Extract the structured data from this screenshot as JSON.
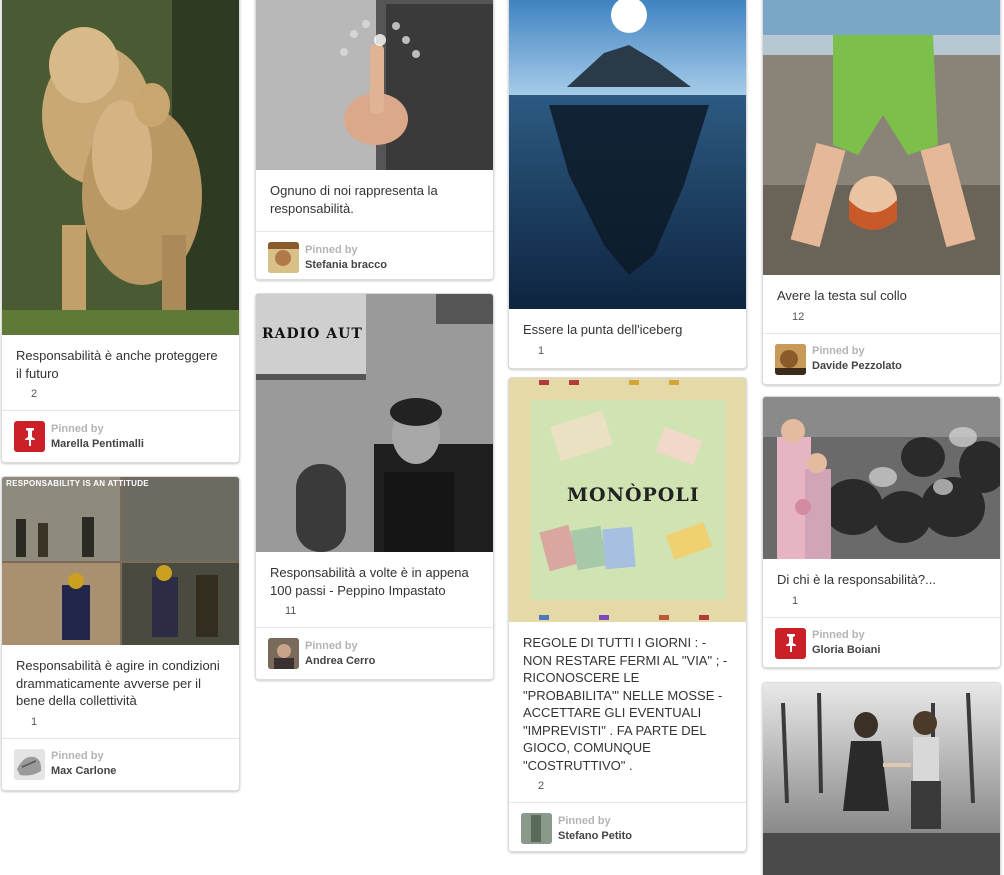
{
  "pinned_by_label": "Pinned by",
  "pins": [
    {
      "description": "Responsabilità è anche proteggere il futuro",
      "repins": "2",
      "pinner": "Marella Pentimalli",
      "image": "lioness-with-cub-photo",
      "avatar": "pinterest-logo-avatar"
    },
    {
      "description": "Responsabilità è agire in condizioni drammaticamente avverse per il bene della collettività",
      "repins": "1",
      "pinner": "Max Carlone",
      "image": "firefighters-collage-photo",
      "image_caption": "RESPONSABILITY IS AN ATTITUDE",
      "avatar": "drawing-avatar"
    },
    {
      "description": "Ognuno di noi rappresenta la responsabilità.",
      "repins": "",
      "pinner": "Stefania bracco",
      "image": "hand-touching-network-photo",
      "avatar": "user-photo-avatar"
    },
    {
      "description": "Responsabilità a volte è in appena 100 passi - Peppino Impastato",
      "repins": "11",
      "pinner": "Andrea Cerro",
      "image": "radio-aut-man-photo",
      "image_sign": "RADIO AUT",
      "avatar": "user-photo-avatar"
    },
    {
      "description": "Essere la punta dell'iceberg",
      "repins": "1",
      "pinner": "",
      "image": "iceberg-photo",
      "avatar": ""
    },
    {
      "description": "REGOLE DI TUTTI I GIORNI : -NON RESTARE FERMI AL \"VIA\" ; -RICONOSCERE LE \"PROBABILITA'\" NELLE MOSSE -ACCETTARE GLI EVENTUALI \"IMPREVISTI\" . FA PARTE DEL GIOCO, COMUNQUE \"COSTRUTTIVO\" .",
      "repins": "2",
      "pinner": "Stefano Petito",
      "image": "monopoli-board-photo",
      "image_title": "MONÒPOLI",
      "avatar": "user-photo-avatar"
    },
    {
      "description": "Avere la testa sul collo",
      "repins": "12",
      "pinner": "Davide Pezzolato",
      "image": "boy-upside-down-photo",
      "avatar": "user-photo-avatar"
    },
    {
      "description": "Di chi è la responsabilità?...",
      "repins": "1",
      "pinner": "Gloria Boiani",
      "image": "children-garbage-photo",
      "avatar": "pinterest-logo-avatar"
    },
    {
      "description": "",
      "repins": "",
      "pinner": "",
      "image": "children-walking-photo",
      "avatar": ""
    }
  ],
  "colors": {
    "brand_red": "#cb2027",
    "card_border": "#dcdcdc",
    "muted_text": "#b4b4b4"
  }
}
